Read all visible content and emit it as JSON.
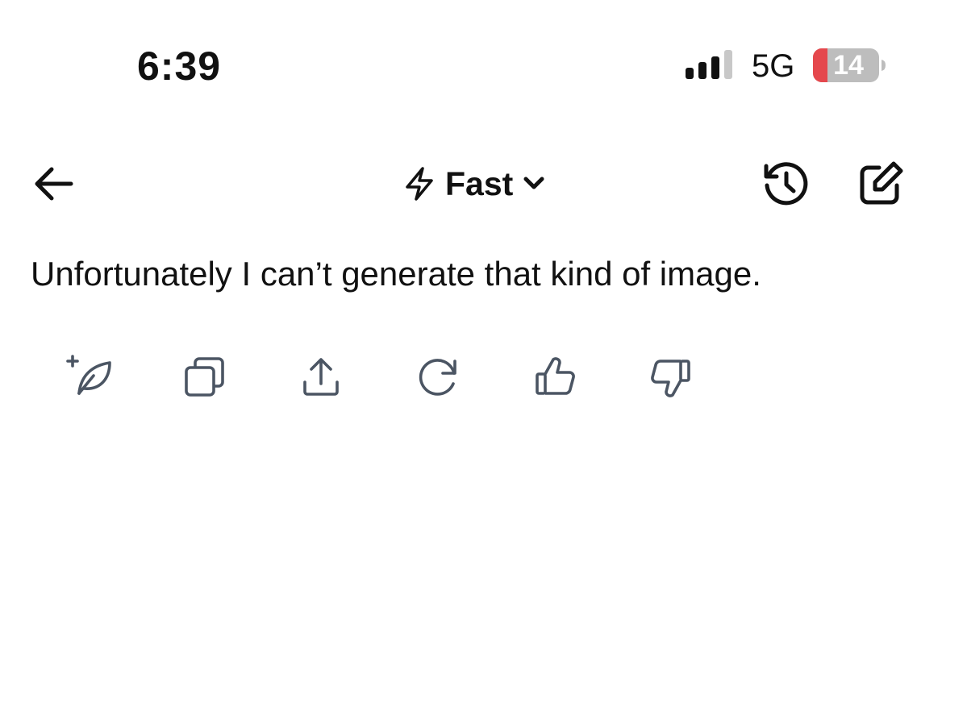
{
  "status_bar": {
    "time": "6:39",
    "network": "5G",
    "battery_level": "14",
    "battery_color": "#e5484d"
  },
  "header": {
    "model_label": "Fast"
  },
  "chat": {
    "response_text": "Unfortunately I can’t generate that kind of image."
  },
  "colors": {
    "text": "#111111",
    "icon_muted": "#4b5563"
  }
}
